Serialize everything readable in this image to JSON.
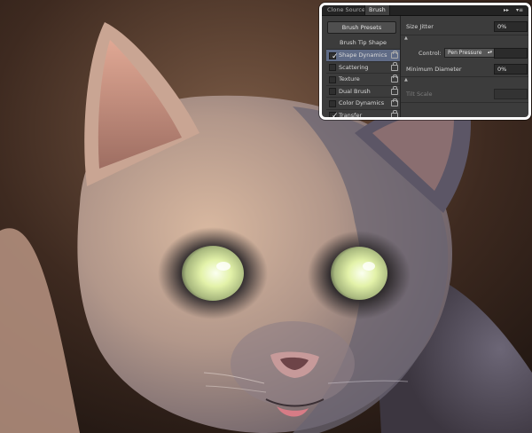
{
  "tabs": {
    "clone_source": "Clone Source",
    "brush": "Brush"
  },
  "tab_controls": {
    "collapse": "▸▸",
    "menu": "▾≡"
  },
  "left": {
    "presets_button": "Brush Presets",
    "tip_shape": "Brush Tip Shape",
    "items": [
      {
        "label": "Shape Dynamics",
        "checked": true,
        "selected": true
      },
      {
        "label": "Scattering",
        "checked": false,
        "selected": false
      },
      {
        "label": "Texture",
        "checked": false,
        "selected": false
      },
      {
        "label": "Dual Brush",
        "checked": false,
        "selected": false
      },
      {
        "label": "Color Dynamics",
        "checked": false,
        "selected": false
      },
      {
        "label": "Transfer",
        "checked": true,
        "selected": false
      }
    ],
    "check_glyph": "✓"
  },
  "right": {
    "size_jitter_label": "Size Jitter",
    "size_jitter_value": "0%",
    "control_label": "Control:",
    "control_value": "Pen Pressure",
    "min_diameter_label": "Minimum Diameter",
    "min_diameter_value": "0%",
    "tilt_scale_label": "Tilt Scale"
  },
  "colors": {
    "accent_selected": "#5f6b86",
    "panel_bg": "#3c3c3c",
    "eye_glow": "#e8f5b6"
  }
}
